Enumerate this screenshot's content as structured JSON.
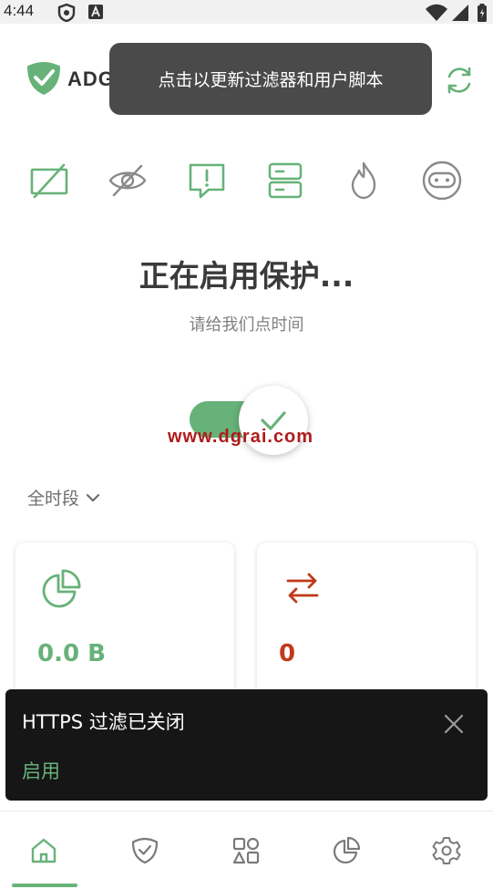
{
  "status_bar": {
    "time": "4:44"
  },
  "header": {
    "logo_text": "ADG",
    "tooltip": "点击以更新过滤器和用户脚本"
  },
  "features": [
    {
      "icon": "ad-blocking-icon"
    },
    {
      "icon": "tracking-protection-icon"
    },
    {
      "icon": "annoyance-blocking-icon"
    },
    {
      "icon": "dns-protection-icon"
    },
    {
      "icon": "firewall-icon"
    },
    {
      "icon": "stealth-mode-icon"
    }
  ],
  "protection": {
    "title": "正在启用保护...",
    "subtitle": "请给我们点时间",
    "enabled": true
  },
  "watermark": "www.dgrai.com",
  "period": {
    "selected": "全时段"
  },
  "stats": [
    {
      "value": "0.0 B",
      "icon": "pie-chart-icon",
      "color": "#67b279"
    },
    {
      "value": "0",
      "icon": "swap-arrows-icon",
      "color": "#c0391b"
    }
  ],
  "snackbar": {
    "message": "HTTPS 过滤已关闭",
    "action": "启用"
  },
  "nav": [
    {
      "icon": "home-icon",
      "active": true
    },
    {
      "icon": "shield-icon",
      "active": false
    },
    {
      "icon": "apps-icon",
      "active": false
    },
    {
      "icon": "statistics-icon",
      "active": false
    },
    {
      "icon": "settings-icon",
      "active": false
    }
  ],
  "colors": {
    "accent": "#67b279",
    "red": "#c0391b",
    "dark": "#161616"
  }
}
